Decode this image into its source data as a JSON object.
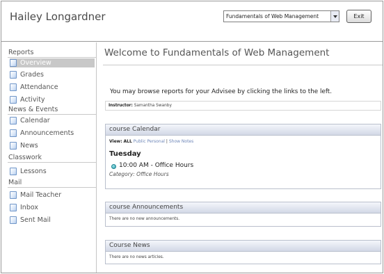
{
  "header": {
    "user_name": "Hailey Longardner",
    "course_select": {
      "selected": "Fundamentals of Web Management"
    },
    "exit_label": "Exit"
  },
  "sidebar": {
    "sections": [
      {
        "title": "Reports",
        "items": [
          {
            "label": "Overview",
            "selected": true
          },
          {
            "label": "Grades"
          },
          {
            "label": "Attendance"
          },
          {
            "label": "Activity"
          }
        ]
      },
      {
        "title": "News & Events",
        "items": [
          {
            "label": "Calendar"
          },
          {
            "label": "Announcements"
          },
          {
            "label": "News"
          }
        ]
      },
      {
        "title": "Classwork",
        "items": [
          {
            "label": "Lessons"
          }
        ]
      },
      {
        "title": "Mail",
        "items": [
          {
            "label": "Mail Teacher"
          },
          {
            "label": "Inbox"
          },
          {
            "label": "Sent Mail"
          }
        ]
      }
    ]
  },
  "main": {
    "title": "Welcome to Fundamentals of Web Management",
    "intro": "You may browse reports for your Advisee by clicking the links to the left.",
    "instructor_label": "Instructor:",
    "instructor_name": "Samantha Swanby",
    "calendar": {
      "header": "course Calendar",
      "view_label": "View:",
      "view_all": "ALL",
      "view_public": "Public",
      "view_personal": "Personal",
      "separator": "|",
      "show_notes": "Show Notes",
      "day": "Tuesday",
      "event": "10:00 AM - Office Hours",
      "category": "Category: Office Hours"
    },
    "announcements": {
      "header": "course Announcements",
      "empty": "There are no new announcements."
    },
    "news": {
      "header": "Course News",
      "empty": "There are no news articles."
    }
  },
  "colors": {
    "selected_nav_bg": "#c8c8c8",
    "panel_header_top": "#f4f6fb",
    "panel_header_bottom": "#d2d8e6",
    "link": "#6d86b8",
    "event_dot": "#2aa0b0"
  },
  "icons": {
    "nav_item": "document-icon",
    "event": "event-dot-icon",
    "select_arrow": "chevron-down-icon"
  }
}
